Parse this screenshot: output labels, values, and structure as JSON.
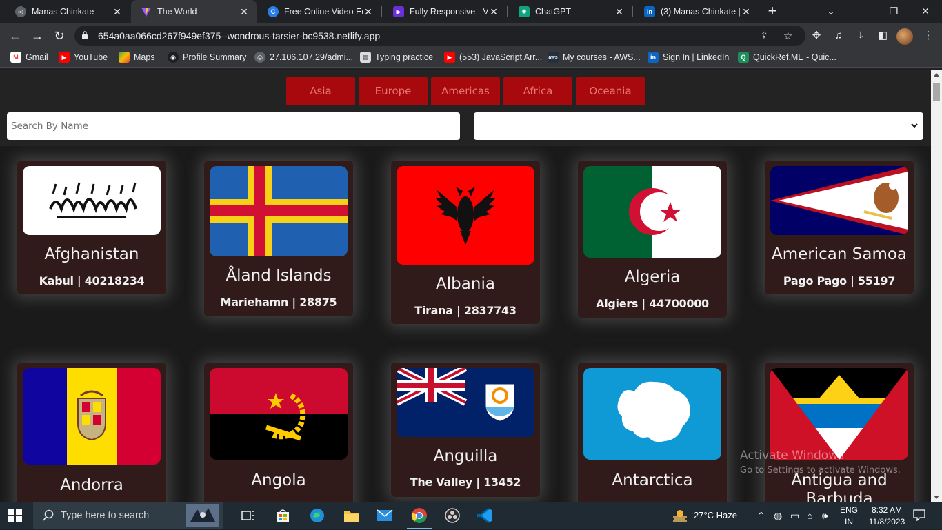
{
  "browser": {
    "tabs": [
      {
        "title": "Manas Chinkate",
        "icon": "globe-icon"
      },
      {
        "title": "The World",
        "icon": "vite-icon",
        "active": true
      },
      {
        "title": "Free Online Video Edi",
        "icon": "canva-icon"
      },
      {
        "title": "Fully Responsive - Vid",
        "icon": "clipchamp-icon"
      },
      {
        "title": "ChatGPT",
        "icon": "openai-icon"
      },
      {
        "title": "(3) Manas Chinkate |",
        "icon": "linkedin-icon"
      }
    ],
    "url": "654a0aa066cd267f949ef375--wondrous-tarsier-bc9538.netlify.app",
    "bookmarks": [
      {
        "label": "Gmail",
        "icon": "gmail-icon"
      },
      {
        "label": "YouTube",
        "icon": "youtube-icon"
      },
      {
        "label": "Maps",
        "icon": "maps-icon"
      },
      {
        "label": "Profile Summary",
        "icon": "github-icon"
      },
      {
        "label": "27.106.107.29/admi...",
        "icon": "globe-icon"
      },
      {
        "label": "Typing practice",
        "icon": "document-icon"
      },
      {
        "label": "(553) JavaScript Arr...",
        "icon": "youtube-icon"
      },
      {
        "label": "My courses - AWS...",
        "icon": "aws-icon"
      },
      {
        "label": "Sign In | LinkedIn",
        "icon": "linkedin-icon"
      },
      {
        "label": "QuickRef.ME - Quic...",
        "icon": "quickref-icon"
      }
    ]
  },
  "app": {
    "regions": [
      "Asia",
      "Europe",
      "Americas",
      "Africa",
      "Oceania"
    ],
    "search": {
      "placeholder": "Search By Name",
      "value": ""
    },
    "region_select": {
      "value": ""
    },
    "countries": [
      {
        "name": "Afghanistan",
        "info": "Kabul | 40218234",
        "flag": "afghanistan"
      },
      {
        "name": "Åland Islands",
        "info": "Mariehamn | 28875",
        "flag": "aland"
      },
      {
        "name": "Albania",
        "info": "Tirana | 2837743",
        "flag": "albania"
      },
      {
        "name": "Algeria",
        "info": "Algiers | 44700000",
        "flag": "algeria"
      },
      {
        "name": "American Samoa",
        "info": "Pago Pago | 55197",
        "flag": "american-samoa"
      },
      {
        "name": "Andorra",
        "info": "",
        "flag": "andorra"
      },
      {
        "name": "Angola",
        "info": "",
        "flag": "angola"
      },
      {
        "name": "Anguilla",
        "info": "The Valley | 13452",
        "flag": "anguilla"
      },
      {
        "name": "Antarctica",
        "info": "",
        "flag": "antarctica"
      },
      {
        "name": "Antigua and Barbuda",
        "info": "",
        "flag": "antigua"
      }
    ],
    "colors": {
      "button_bg": "#a8090d",
      "button_text": "#e67474",
      "card_bg": "#301a1a",
      "page_bg": "#1a1a1a"
    }
  },
  "watermark": {
    "line1": "Activate Windows",
    "line2": "Go to Settings to activate Windows."
  },
  "taskbar": {
    "search_placeholder": "Type here to search",
    "weather": "27°C  Haze",
    "lang_top": "ENG",
    "lang_bottom": "IN",
    "time": "8:32 AM",
    "date": "11/8/2023"
  }
}
